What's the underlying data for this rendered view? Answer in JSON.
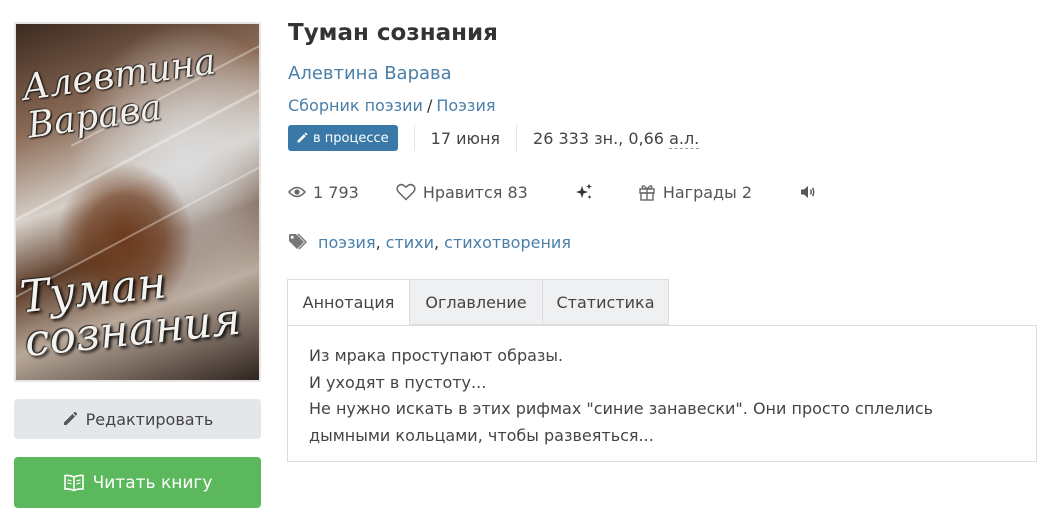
{
  "book": {
    "cover_author": "Алевтина Варава",
    "cover_title": "Туман сознания",
    "title": "Туман сознания",
    "author": "Алевтина Варава",
    "genre": "Сборник поэзии",
    "subgenre": "Поэзия",
    "status_badge": "в процессе",
    "date": "17 июня",
    "size_text": "26 333 зн., 0,66 ",
    "size_unit": "а.л."
  },
  "stats": {
    "views": "1 793",
    "likes_label": "Нравится",
    "likes_count": "83",
    "awards_label": "Награды",
    "awards_count": "2"
  },
  "tags": [
    "поэзия",
    "стихи",
    "стихотворения"
  ],
  "tabs": [
    {
      "label": "Аннотация",
      "active": true
    },
    {
      "label": "Оглавление",
      "active": false
    },
    {
      "label": "Статистика",
      "active": false
    }
  ],
  "annotation": [
    "Из мрака проступают образы.",
    "И уходят в пустоту...",
    "Не нужно искать в этих рифмах \"синие занавески\". Они просто сплелись дымными кольцами, чтобы развеяться..."
  ],
  "buttons": {
    "edit": "Редактировать",
    "read": "Читать книгу"
  },
  "colors": {
    "link": "#4a7fa8",
    "badge": "#3a78a8",
    "read_button": "#5cb85c",
    "edit_button": "#e4e7ea"
  },
  "icons": [
    "pencil-icon",
    "book-open-icon",
    "eye-icon",
    "heart-icon",
    "sparkles-icon",
    "gift-icon",
    "speaker-icon",
    "tags-icon"
  ]
}
